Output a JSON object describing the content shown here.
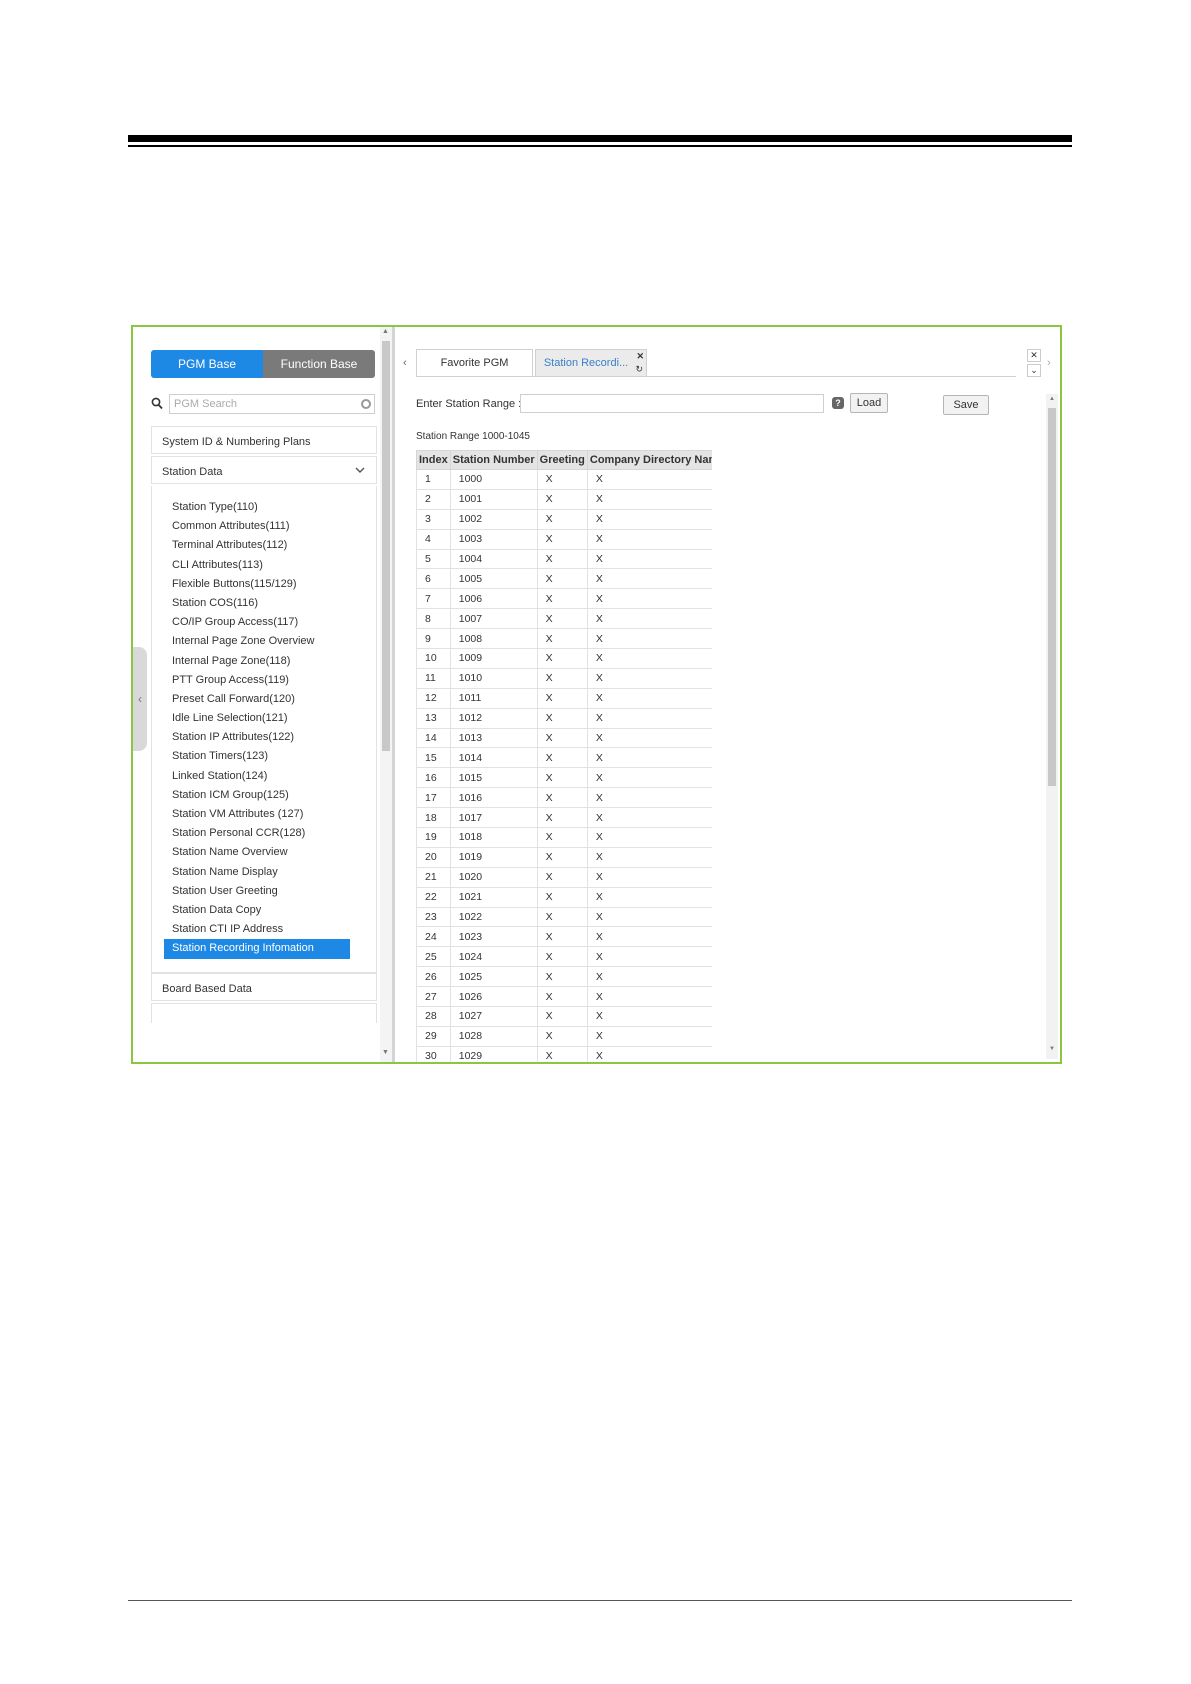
{
  "sidebar": {
    "toggle": {
      "pgm_base": "PGM Base",
      "function_base": "Function Base"
    },
    "search": {
      "placeholder": "PGM Search"
    },
    "sections": {
      "system_id": "System ID & Numbering Plans",
      "station_data": "Station Data",
      "board_based": "Board Based Data"
    },
    "station_items": [
      "Station Type(110)",
      "Common Attributes(111)",
      "Terminal Attributes(112)",
      "CLI Attributes(113)",
      "Flexible Buttons(115/129)",
      "Station COS(116)",
      "CO/IP Group Access(117)",
      "Internal Page Zone Overview",
      "Internal Page Zone(118)",
      "PTT Group Access(119)",
      "Preset Call Forward(120)",
      "Idle Line Selection(121)",
      "Station IP Attributes(122)",
      "Station Timers(123)",
      "Linked Station(124)",
      "Station ICM Group(125)",
      "Station VM Attributes (127)",
      "Station Personal CCR(128)",
      "Station Name Overview",
      "Station Name Display",
      "Station User Greeting",
      "Station Data Copy",
      "Station CTI IP Address",
      "Station Recording Infomation"
    ],
    "active_item_index": 23
  },
  "tabs": [
    {
      "label": "Favorite PGM"
    },
    {
      "label": "Station Recordi..."
    }
  ],
  "form": {
    "range_label": "Enter Station Range :",
    "range_value": "",
    "help_glyph": "?",
    "load_label": "Load",
    "save_label": "Save",
    "range_caption": "Station Range 1000-1045"
  },
  "table": {
    "headers": [
      "Index",
      "Station Number",
      "Greeting",
      "Company Directory Name"
    ],
    "rows": [
      [
        "1",
        "1000",
        "X",
        "X"
      ],
      [
        "2",
        "1001",
        "X",
        "X"
      ],
      [
        "3",
        "1002",
        "X",
        "X"
      ],
      [
        "4",
        "1003",
        "X",
        "X"
      ],
      [
        "5",
        "1004",
        "X",
        "X"
      ],
      [
        "6",
        "1005",
        "X",
        "X"
      ],
      [
        "7",
        "1006",
        "X",
        "X"
      ],
      [
        "8",
        "1007",
        "X",
        "X"
      ],
      [
        "9",
        "1008",
        "X",
        "X"
      ],
      [
        "10",
        "1009",
        "X",
        "X"
      ],
      [
        "11",
        "1010",
        "X",
        "X"
      ],
      [
        "12",
        "1011",
        "X",
        "X"
      ],
      [
        "13",
        "1012",
        "X",
        "X"
      ],
      [
        "14",
        "1013",
        "X",
        "X"
      ],
      [
        "15",
        "1014",
        "X",
        "X"
      ],
      [
        "16",
        "1015",
        "X",
        "X"
      ],
      [
        "17",
        "1016",
        "X",
        "X"
      ],
      [
        "18",
        "1017",
        "X",
        "X"
      ],
      [
        "19",
        "1018",
        "X",
        "X"
      ],
      [
        "20",
        "1019",
        "X",
        "X"
      ],
      [
        "21",
        "1020",
        "X",
        "X"
      ],
      [
        "22",
        "1021",
        "X",
        "X"
      ],
      [
        "23",
        "1022",
        "X",
        "X"
      ],
      [
        "24",
        "1023",
        "X",
        "X"
      ],
      [
        "25",
        "1024",
        "X",
        "X"
      ],
      [
        "26",
        "1025",
        "X",
        "X"
      ],
      [
        "27",
        "1026",
        "X",
        "X"
      ],
      [
        "28",
        "1027",
        "X",
        "X"
      ],
      [
        "29",
        "1028",
        "X",
        "X"
      ],
      [
        "30",
        "1029",
        "X",
        "X"
      ]
    ]
  },
  "colors": {
    "accent": "#1e88e5",
    "frame_border": "#8cc63f",
    "inactive_toggle": "#7a7a7a",
    "tab_active_text": "#3a7fc9"
  },
  "icons": {
    "search": "search-icon",
    "clear": "clear-icon",
    "chevron": "chevron-down-icon",
    "close": "close-icon",
    "refresh": "refresh-icon",
    "help": "help-icon"
  }
}
